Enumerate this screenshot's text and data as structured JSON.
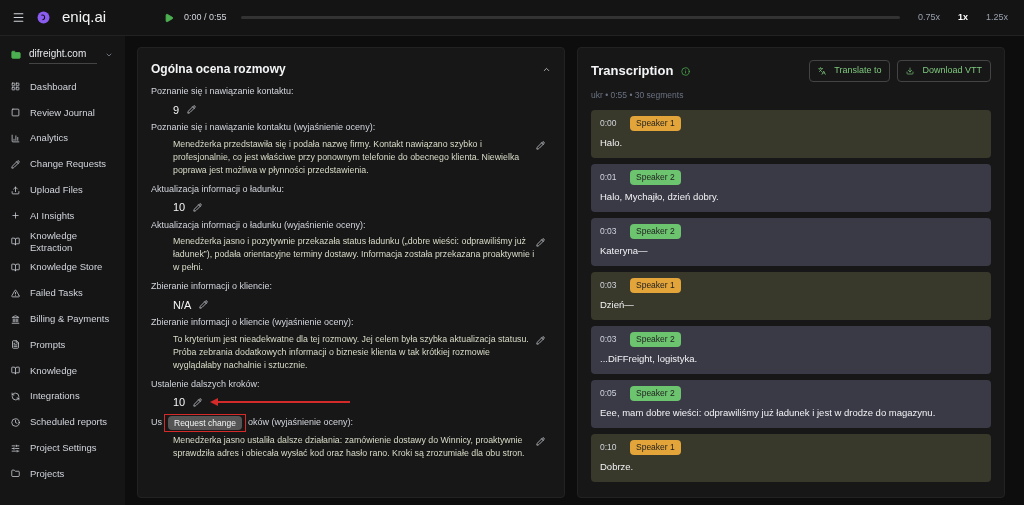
{
  "app": {
    "name": "eniq.ai"
  },
  "player": {
    "time": "0:00 / 0:55",
    "speeds": [
      {
        "label": "0.75x",
        "selected": false
      },
      {
        "label": "1x",
        "selected": true
      },
      {
        "label": "1.25x",
        "selected": false
      }
    ]
  },
  "sidebar": {
    "workspace": "difreight.com",
    "items": [
      {
        "label": "Dashboard"
      },
      {
        "label": "Review Journal"
      },
      {
        "label": "Analytics"
      },
      {
        "label": "Change Requests"
      },
      {
        "label": "Upload Files"
      },
      {
        "label": "AI Insights"
      },
      {
        "label": "Knowledge Extraction"
      },
      {
        "label": "Knowledge Store"
      },
      {
        "label": "Failed Tasks"
      },
      {
        "label": "Billing & Payments"
      },
      {
        "label": "Prompts"
      },
      {
        "label": "Knowledge"
      },
      {
        "label": "Integrations"
      },
      {
        "label": "Scheduled reports"
      },
      {
        "label": "Project Settings"
      },
      {
        "label": "Projects"
      }
    ]
  },
  "evaluation": {
    "title": "Ogólna ocena rozmowy",
    "expanded": true,
    "criteria": [
      {
        "label": "Poznanie się i nawiązanie kontaktu:",
        "score": "9",
        "explanation_label": "Poznanie się i nawiązanie kontaktu (wyjaśnienie oceny):",
        "explanation": "Menedżerka przedstawiła się i podała nazwę firmy. Kontakt nawiązano szybko i profesjonalnie, co jest właściwe przy ponownym telefonie do obecnego klienta. Niewielka poprawa jest możliwa w płynności przedstawienia."
      },
      {
        "label": "Aktualizacja informacji o ładunku:",
        "score": "10",
        "explanation_label": "Aktualizacja informacji o ładunku (wyjaśnienie oceny):",
        "explanation": "Menedżerka jasno i pozytywnie przekazała status ładunku („dobre wieści: odprawiliśmy już ładunek”), podała orientacyjne terminy dostawy. Informacja została przekazana proaktywnie i w pełni."
      },
      {
        "label": "Zbieranie informacji o kliencie:",
        "score": "N/A",
        "explanation_label": "Zbieranie informacji o kliencie (wyjaśnienie oceny):",
        "explanation": "To kryterium jest nieadekwatne dla tej rozmowy. Jej celem była szybka aktualizacja statusu. Próba zebrania dodatkowych informacji o biznesie klienta w tak krótkiej rozmowie wyglądałaby nachalnie i sztucznie."
      },
      {
        "label": "Ustalenie dalszych kroków:",
        "score": "10",
        "annotated": true,
        "explanation_label_parts": [
          "Us",
          "oków (wyjaśnienie oceny):"
        ],
        "tooltip": "Request change",
        "explanation": "Menedżerka jasno ustaliła dalsze działania: zamówienie dostawy do Winnicy, proaktywnie sprawdziła adres i obiecała wysłać kod oraz hasło rano. Kroki są zrozumiałe dla obu stron."
      }
    ]
  },
  "transcription": {
    "title": "Transcription",
    "buttons": [
      {
        "label": "Translate to"
      },
      {
        "label": "Download VTT"
      }
    ],
    "meta": "ukr • 0:55 • 30 segments",
    "segments": [
      {
        "time": "0:00",
        "speaker": "Speaker 1",
        "color": "#e3a43a",
        "text": "Halo."
      },
      {
        "time": "0:01",
        "speaker": "Speaker 2",
        "color": "#6cc46f",
        "text": "Halo, Mychajło, dzień dobry."
      },
      {
        "time": "0:03",
        "speaker": "Speaker 2",
        "color": "#6cc46f",
        "text": "Kateryna—"
      },
      {
        "time": "0:03",
        "speaker": "Speaker 1",
        "color": "#e3a43a",
        "text": "Dzień—"
      },
      {
        "time": "0:03",
        "speaker": "Speaker 2",
        "color": "#6cc46f",
        "text": "...DiFFreight, logistyka."
      },
      {
        "time": "0:05",
        "speaker": "Speaker 2",
        "color": "#6cc46f",
        "text": "Eee, mam dobre wieści: odprawiliśmy już ładunek i jest w drodze do magazynu."
      },
      {
        "time": "0:10",
        "speaker": "Speaker 1",
        "color": "#e3a43a",
        "text": "Dobrze."
      }
    ]
  }
}
